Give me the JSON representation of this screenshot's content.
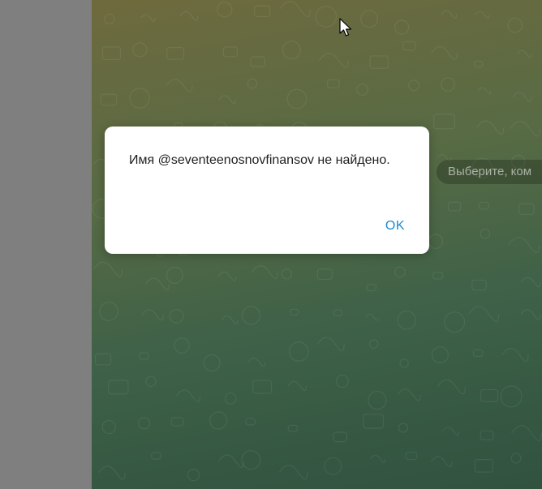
{
  "chat": {
    "service_hint": "Выберите, ком"
  },
  "dialog": {
    "message": "Имя @seventeenosnovfinansov не найдено.",
    "ok_label": "OK"
  },
  "colors": {
    "sidebar_dim": "#7f7f7f",
    "accent": "#1a8ad4",
    "dialog_bg": "#ffffff"
  },
  "icons": {
    "cursor": "mouse-pointer-icon"
  }
}
